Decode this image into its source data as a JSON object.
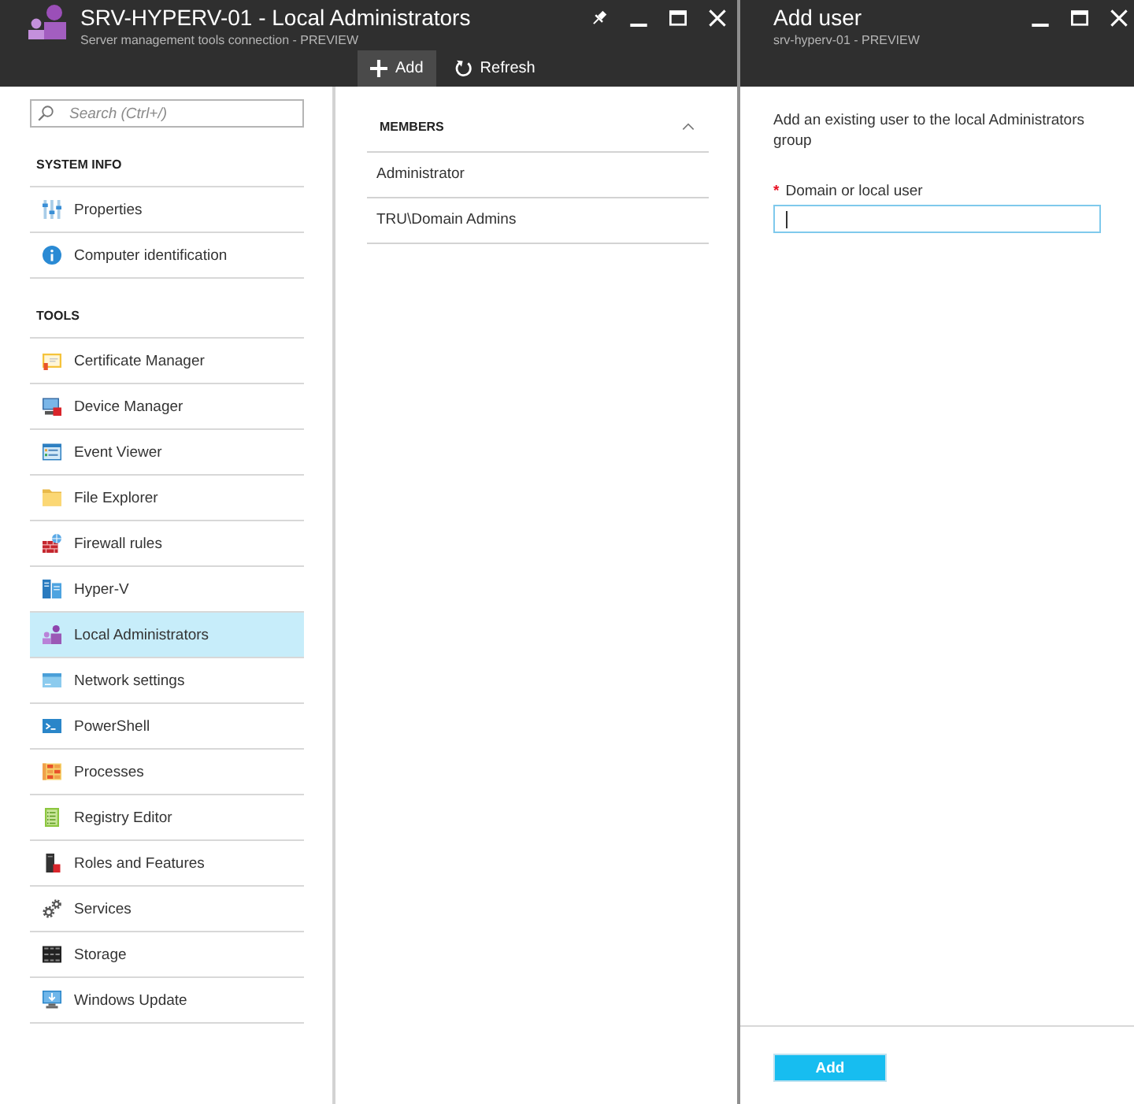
{
  "main_blade": {
    "title": "SRV-HYPERV-01 - Local Administrators",
    "subtitle": "Server management tools connection - PREVIEW",
    "toolbar": [
      {
        "kind": "add",
        "label": "Add",
        "active": true
      },
      {
        "kind": "refresh",
        "label": "Refresh",
        "active": false
      }
    ]
  },
  "sidebar": {
    "search": {
      "placeholder": "Search (Ctrl+/)"
    },
    "sections": [
      {
        "heading": "SYSTEM INFO",
        "items": [
          {
            "kind": "properties",
            "label": "Properties",
            "selected": false
          },
          {
            "kind": "info",
            "label": "Computer identification",
            "selected": false
          }
        ]
      },
      {
        "heading": "TOOLS",
        "items": [
          {
            "kind": "certificate",
            "label": "Certificate Manager",
            "selected": false
          },
          {
            "kind": "device",
            "label": "Device Manager",
            "selected": false
          },
          {
            "kind": "events",
            "label": "Event Viewer",
            "selected": false
          },
          {
            "kind": "folder",
            "label": "File Explorer",
            "selected": false
          },
          {
            "kind": "firewall",
            "label": "Firewall rules",
            "selected": false
          },
          {
            "kind": "hyperv",
            "label": "Hyper-V",
            "selected": false
          },
          {
            "kind": "admins",
            "label": "Local Administrators",
            "selected": true
          },
          {
            "kind": "network",
            "label": "Network settings",
            "selected": false
          },
          {
            "kind": "powershell",
            "label": "PowerShell",
            "selected": false
          },
          {
            "kind": "processes",
            "label": "Processes",
            "selected": false
          },
          {
            "kind": "registry",
            "label": "Registry Editor",
            "selected": false
          },
          {
            "kind": "roles",
            "label": "Roles and Features",
            "selected": false
          },
          {
            "kind": "services",
            "label": "Services",
            "selected": false
          },
          {
            "kind": "storage",
            "label": "Storage",
            "selected": false
          },
          {
            "kind": "update",
            "label": "Windows Update",
            "selected": false
          }
        ]
      }
    ]
  },
  "members": {
    "heading": "MEMBERS",
    "expanded": true,
    "rows": [
      "Administrator",
      "TRU\\Domain Admins"
    ]
  },
  "add_user_blade": {
    "title": "Add user",
    "subtitle": "srv-hyperv-01 - PREVIEW",
    "description": "Add an existing user to the local Administrators group",
    "field": {
      "required_mark": "*",
      "label": "Domain or local user",
      "focused": true
    },
    "button": "Add"
  }
}
